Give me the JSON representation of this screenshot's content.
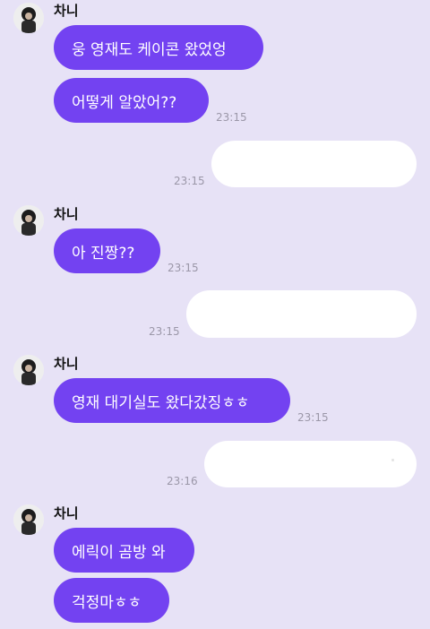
{
  "contact": {
    "name": "차니"
  },
  "messages": [
    {
      "from": "incoming",
      "text": "웅 영재도 케이콘 왔었엉"
    },
    {
      "from": "incoming",
      "text": "어떻게 알았어??",
      "time": "23:15"
    },
    {
      "from": "outgoing",
      "text": "",
      "time": "23:15"
    },
    {
      "from": "incoming",
      "text": "아 진짱??",
      "time": "23:15"
    },
    {
      "from": "outgoing",
      "text": "",
      "time": "23:15"
    },
    {
      "from": "incoming",
      "text": "영재 대기실도 왔다갔징ㅎㅎ",
      "time": "23:15"
    },
    {
      "from": "outgoing",
      "text": "",
      "time": "23:16"
    },
    {
      "from": "incoming",
      "text": "에릭이 곰방 와"
    },
    {
      "from": "incoming",
      "text": "걱정마ㅎㅎ"
    }
  ],
  "colors": {
    "background": "#e7e2f6",
    "incoming_bubble": "#7342f1",
    "outgoing_bubble": "#ffffff"
  }
}
